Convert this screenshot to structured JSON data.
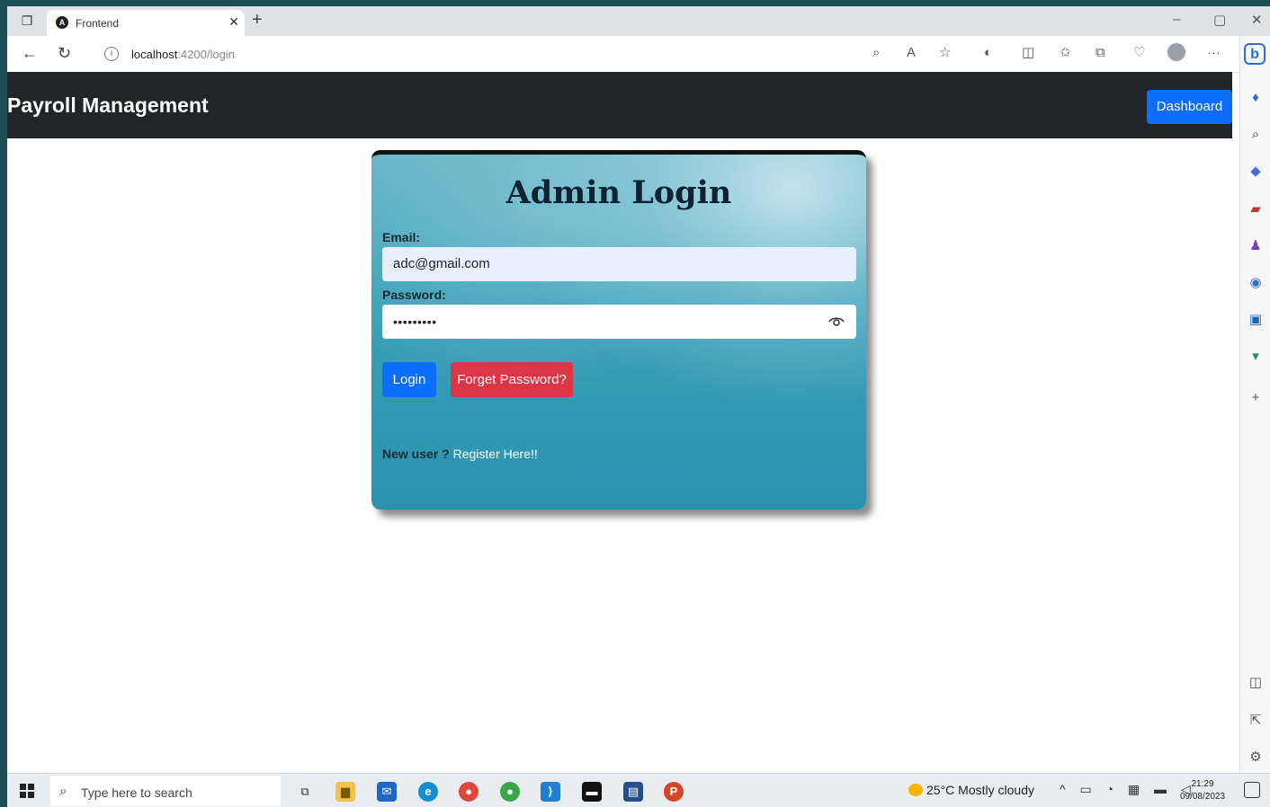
{
  "browser": {
    "tab_title": "Frontend",
    "tab_favicon": "angular-logo-icon",
    "url_host": "localhost",
    "url_rest": ":4200/login",
    "window_buttons": [
      "–",
      "▢",
      "✕"
    ]
  },
  "app": {
    "brand": "Payroll Management",
    "dashboard_label": "Dashboard"
  },
  "login": {
    "title": "Admin Login",
    "email_label": "Email:",
    "email_value": "adc@gmail.com",
    "password_label": "Password:",
    "password_value": "•••••••••",
    "login_label": "Login",
    "forget_label": "Forget Password?",
    "new_user_text": "New user ?",
    "register_label": "Register Here!!"
  },
  "colors": {
    "navbar": "#212529",
    "primary": "#0d6efd",
    "danger": "#dc3545",
    "card_teal": "#3aa0b8"
  },
  "taskbar": {
    "search_placeholder": "Type here to search",
    "weather": "25°C  Mostly cloudy",
    "time": "21:29",
    "date": "09/08/2023"
  }
}
